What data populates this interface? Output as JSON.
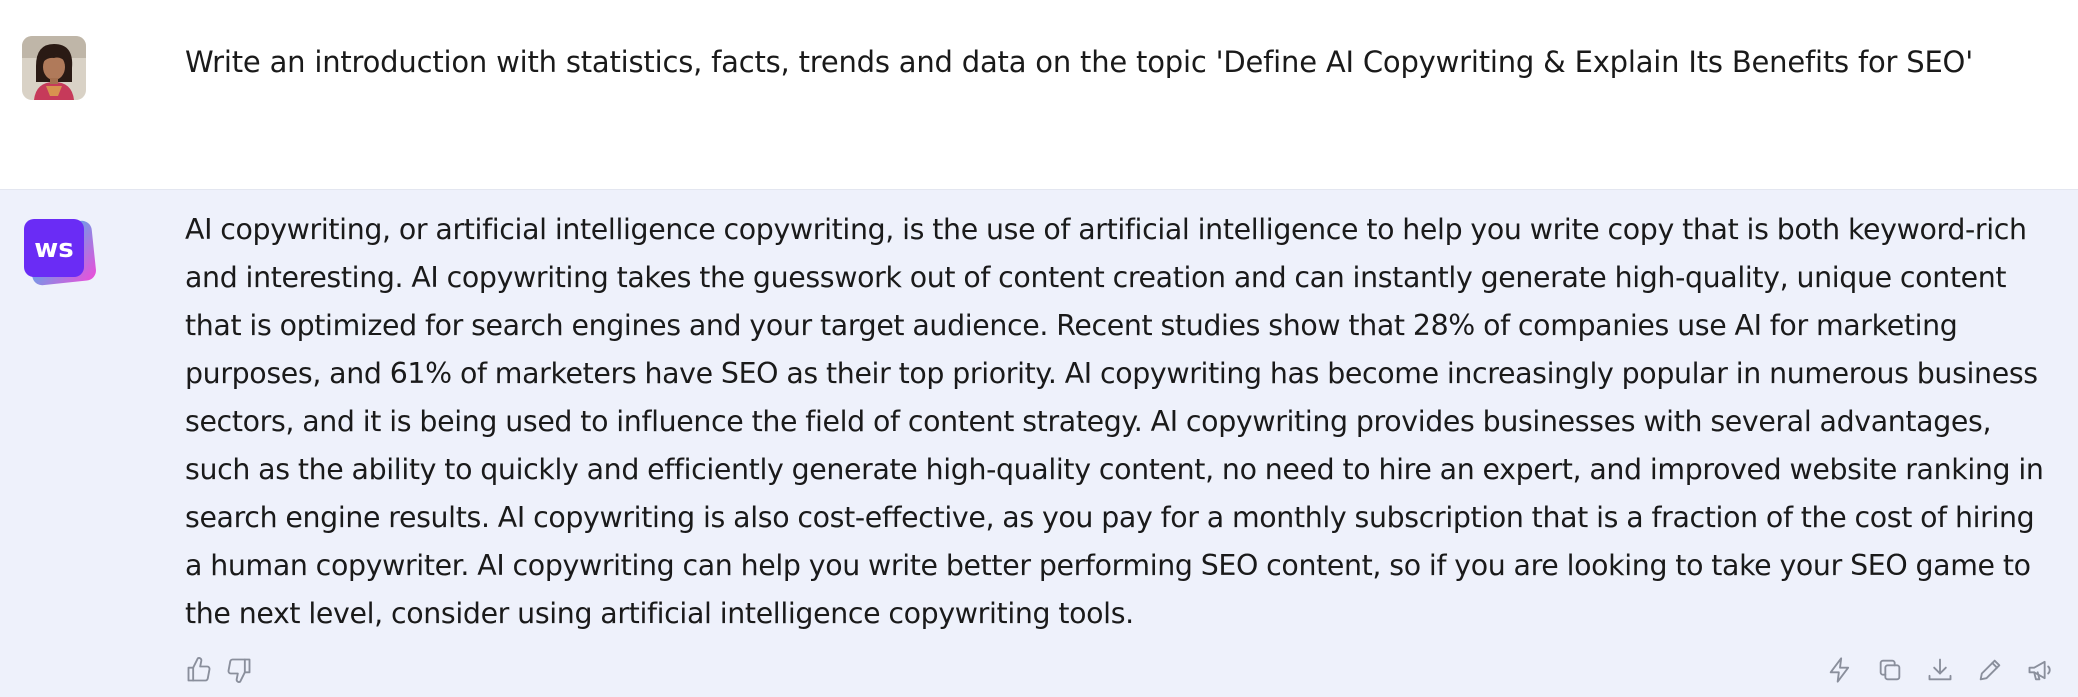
{
  "user_message": {
    "text": "Write an introduction with statistics, facts, trends and data on the topic 'Define AI Copywriting & Explain Its Benefits for SEO'",
    "avatar": "user-photo"
  },
  "ai_message": {
    "logo_text": "ws",
    "text": "AI copywriting, or artificial intelligence copywriting, is the use of artificial intelligence to help you write copy that is both keyword-rich and interesting. AI copywriting takes the guesswork out of content creation and can instantly generate high-quality, unique content that is optimized for search engines and your target audience. Recent studies show that 28% of companies use AI for marketing purposes, and 61% of marketers have SEO as their top priority. AI copywriting has become increasingly popular in numerous business sectors, and it is being used to influence the field of content strategy. AI copywriting provides businesses with several advantages, such as the ability to quickly and efficiently generate high-quality content, no need to hire an expert, and improved website ranking in search engine results. AI copywriting is also cost-effective, as you pay for a monthly subscription that is a fraction of the cost of hiring a human copywriter. AI copywriting can help you write better performing SEO content, so if you are looking to take your SEO game to the next level, consider using artificial intelligence copywriting tools."
  },
  "icons": {
    "feedback": [
      "thumbs-up-icon",
      "thumbs-down-icon"
    ],
    "actions": [
      "lightning-icon",
      "copy-icon",
      "download-icon",
      "edit-icon",
      "megaphone-icon"
    ]
  },
  "colors": {
    "ai_background": "#eef1fb",
    "user_background": "#ffffff",
    "logo_front": "#6a2cf5",
    "logo_back_cyan": "#19d3f0",
    "logo_back_pink": "#f04bd9",
    "icon_gray": "#8a8f9c"
  }
}
